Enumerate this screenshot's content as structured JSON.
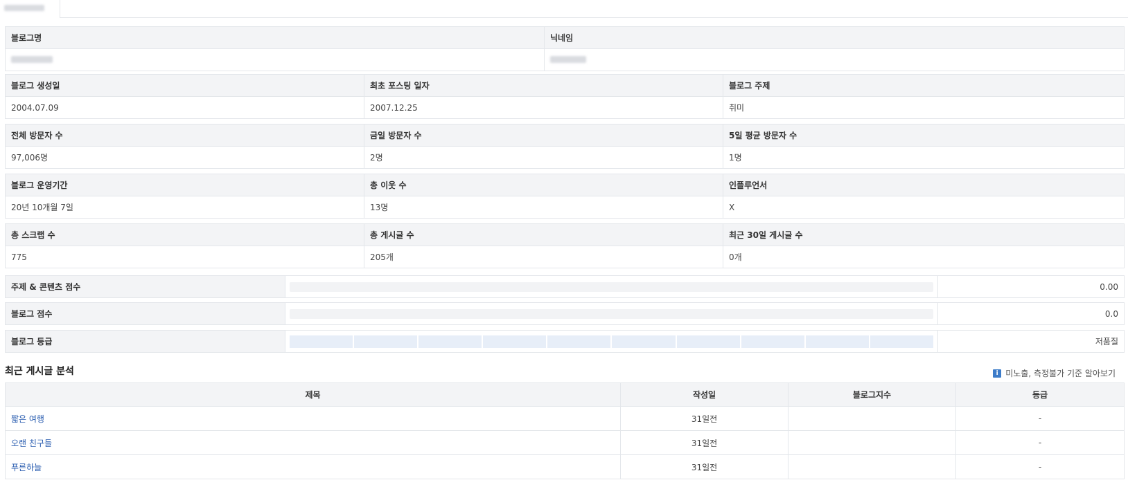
{
  "top_tab": {
    "label": ""
  },
  "blog_row": {
    "headers": [
      "블로그명",
      "닉네임"
    ],
    "values": [
      "",
      ""
    ]
  },
  "info_rows": [
    {
      "headers": [
        "블로그 생성일",
        "최초 포스팅 일자",
        "블로그 주제"
      ],
      "values": [
        "2004.07.09",
        "2007.12.25",
        "취미"
      ]
    },
    {
      "headers": [
        "전체 방문자 수",
        "금일 방문자 수",
        "5일 평균 방문자 수"
      ],
      "values": [
        "97,006명",
        "2명",
        "1명"
      ]
    },
    {
      "headers": [
        "블로그 운영기간",
        "총 이웃 수",
        "인플루언서"
      ],
      "values": [
        "20년 10개월 7일",
        "13명",
        "X"
      ]
    },
    {
      "headers": [
        "총 스크랩 수",
        "총 게시글 수",
        "최근 30일 게시글 수"
      ],
      "values": [
        "775",
        "205개",
        "0개"
      ]
    }
  ],
  "scores": [
    {
      "label": "주제 & 콘텐츠 점수",
      "value": "0.00",
      "fill_fraction": 0
    },
    {
      "label": "블로그 점수",
      "value": "0.0",
      "fill_fraction": 0
    }
  ],
  "grade": {
    "label": "블로그 등급",
    "value": "저품질",
    "segments": 10,
    "filled_segments": 0
  },
  "recent_posts": {
    "title": "최근 게시글 분석",
    "help_text": "미노출, 측정불가 기준 알아보기",
    "help_icon": "info-icon",
    "columns": [
      "제목",
      "작성일",
      "블로그지수",
      "등급"
    ],
    "rows": [
      {
        "title": "짧은 여행",
        "date": "31일전",
        "index": "",
        "grade": "-"
      },
      {
        "title": "오랜 친구들",
        "date": "31일전",
        "index": "",
        "grade": "-"
      },
      {
        "title": "푸른하늘",
        "date": "31일전",
        "index": "",
        "grade": "-"
      }
    ]
  },
  "colors": {
    "header_bg": "#f3f4f6",
    "border": "#e3e6ea",
    "link": "#2a5db0",
    "grade_segment": "#e7eef8",
    "info_icon": "#3d7cc9"
  }
}
